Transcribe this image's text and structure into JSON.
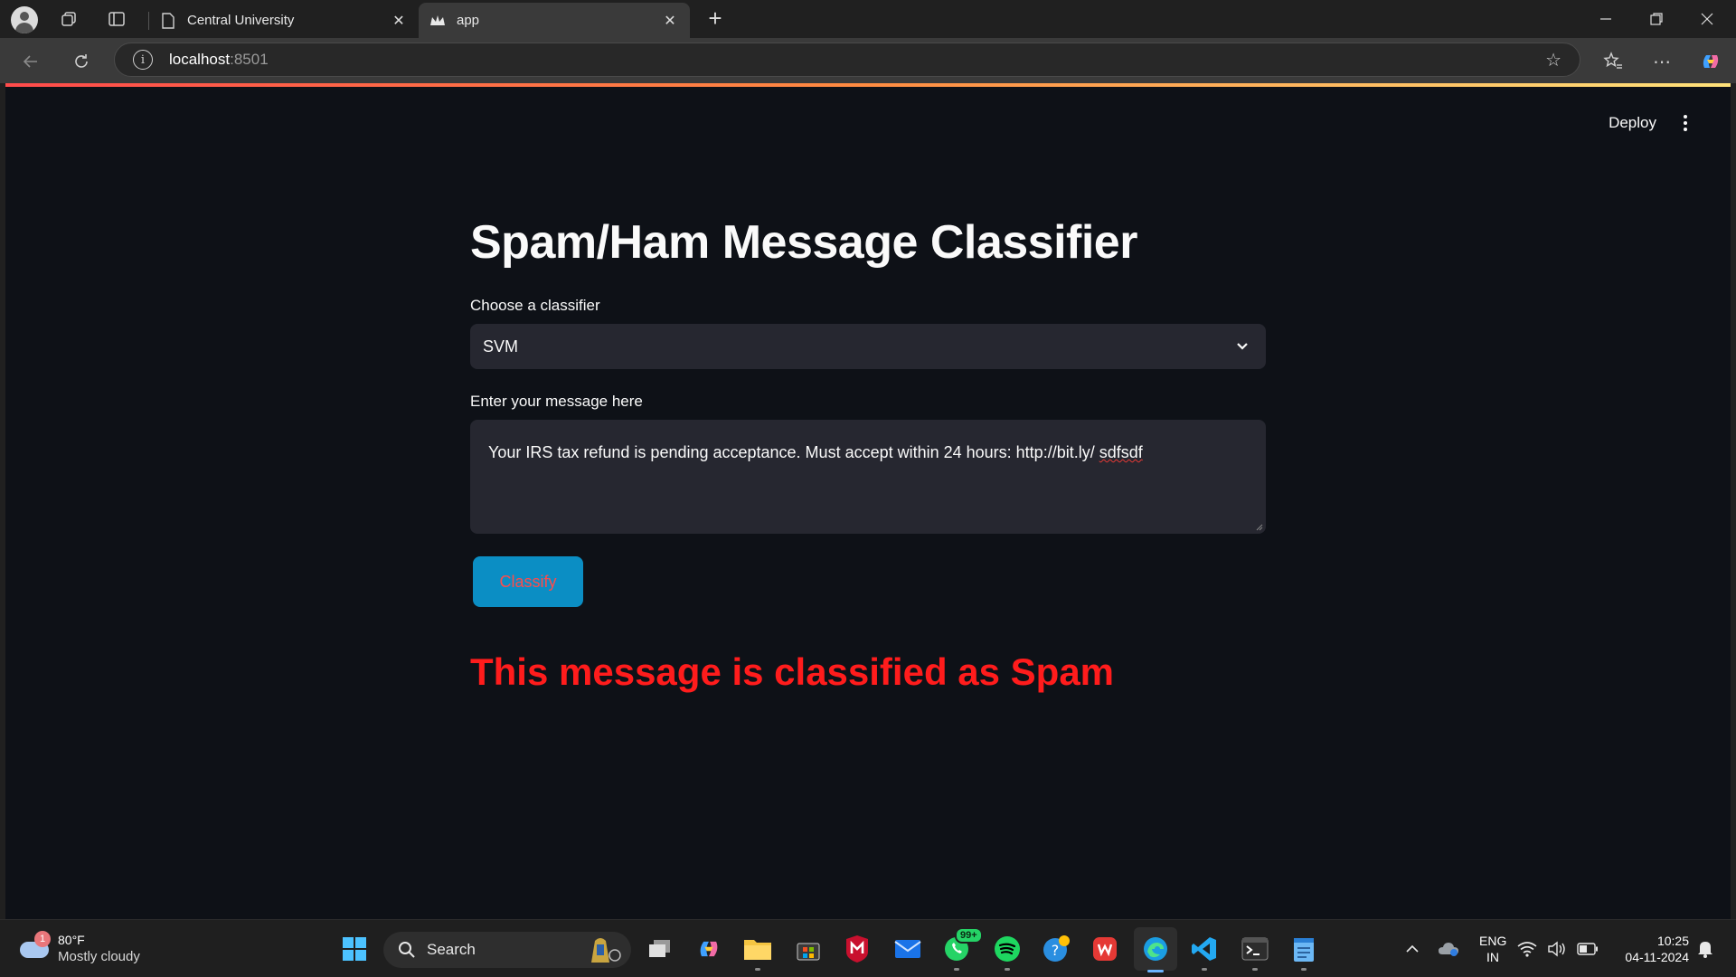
{
  "browser": {
    "tabs": [
      {
        "title": "Central University",
        "active": false
      },
      {
        "title": "app",
        "active": true
      }
    ],
    "address": {
      "host": "localhost",
      "port": ":8501"
    }
  },
  "app": {
    "header": {
      "deploy_label": "Deploy"
    },
    "title": "Spam/Ham Message Classifier",
    "classifier_label": "Choose a classifier",
    "classifier_selected": "SVM",
    "message_label": "Enter your message here",
    "message_value_main": "Your IRS tax refund is pending acceptance. Must accept within 24 hours: http://bit.ly/ ",
    "message_value_typo": "sdfsdf",
    "button_label": "Classify",
    "result": "This message is classified as Spam",
    "colors": {
      "background": "#0e1117",
      "button": "#0b8ec4",
      "button_text": "#ff4b4b",
      "result": "#ff1c1c"
    }
  },
  "taskbar": {
    "weather": {
      "badge": "1",
      "temp": "80°F",
      "desc": "Mostly cloudy"
    },
    "search_label": "Search",
    "whatsapp_badge": "99+",
    "lang": {
      "line1": "ENG",
      "line2": "IN"
    },
    "clock": {
      "time": "10:25",
      "date": "04-11-2024"
    }
  }
}
